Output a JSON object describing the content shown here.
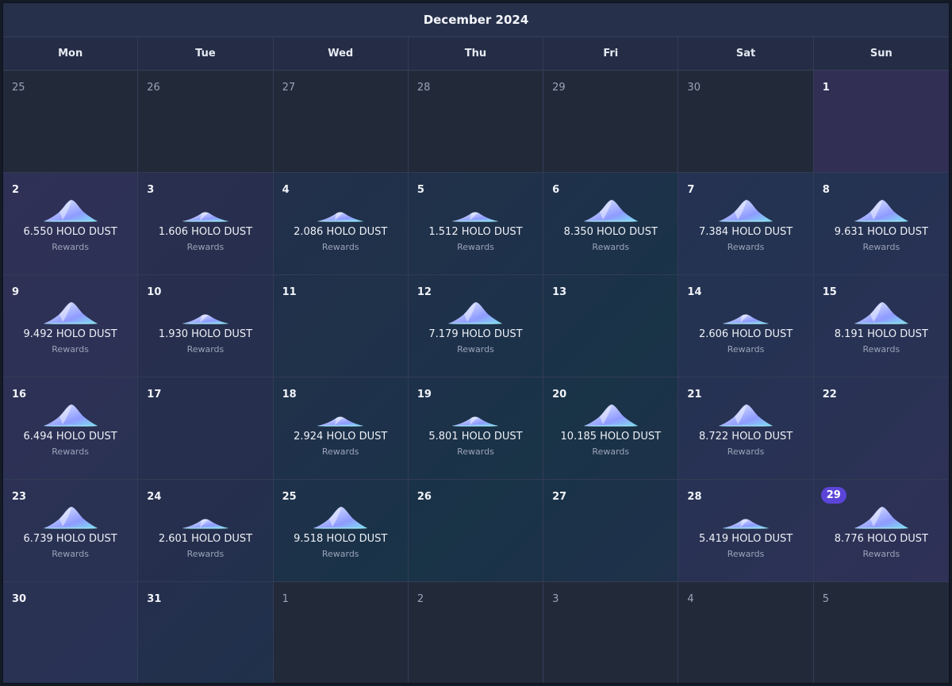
{
  "calendar": {
    "month_title": "December 2024",
    "weekdays": [
      "Mon",
      "Tue",
      "Wed",
      "Thu",
      "Fri",
      "Sat",
      "Sun"
    ],
    "reward_unit": "HOLO DUST",
    "reward_label": "Rewards",
    "today": "29",
    "reward_icon": "holo-dust-pile-icon",
    "accent_color": "#5b45d8",
    "cells": [
      {
        "day": "25",
        "outside": true
      },
      {
        "day": "26",
        "outside": true
      },
      {
        "day": "27",
        "outside": true
      },
      {
        "day": "28",
        "outside": true
      },
      {
        "day": "29",
        "outside": true
      },
      {
        "day": "30",
        "outside": true
      },
      {
        "day": "1"
      },
      {
        "day": "2",
        "amount": "6.550 HOLO DUST",
        "pile": 3
      },
      {
        "day": "3",
        "amount": "1.606 HOLO DUST",
        "pile": 1
      },
      {
        "day": "4",
        "amount": "2.086 HOLO DUST",
        "pile": 1
      },
      {
        "day": "5",
        "amount": "1.512 HOLO DUST",
        "pile": 1
      },
      {
        "day": "6",
        "amount": "8.350 HOLO DUST",
        "pile": 3
      },
      {
        "day": "7",
        "amount": "7.384 HOLO DUST",
        "pile": 3
      },
      {
        "day": "8",
        "amount": "9.631 HOLO DUST",
        "pile": 3
      },
      {
        "day": "9",
        "amount": "9.492 HOLO DUST",
        "pile": 3
      },
      {
        "day": "10",
        "amount": "1.930 HOLO DUST",
        "pile": 1
      },
      {
        "day": "11"
      },
      {
        "day": "12",
        "amount": "7.179 HOLO DUST",
        "pile": 3
      },
      {
        "day": "13"
      },
      {
        "day": "14",
        "amount": "2.606 HOLO DUST",
        "pile": 1
      },
      {
        "day": "15",
        "amount": "8.191 HOLO DUST",
        "pile": 3
      },
      {
        "day": "16",
        "amount": "6.494 HOLO DUST",
        "pile": 3
      },
      {
        "day": "17"
      },
      {
        "day": "18",
        "amount": "2.924 HOLO DUST",
        "pile": 1
      },
      {
        "day": "19",
        "amount": "5.801 HOLO DUST",
        "pile": 1
      },
      {
        "day": "20",
        "amount": "10.185 HOLO DUST",
        "pile": 3
      },
      {
        "day": "21",
        "amount": "8.722 HOLO DUST",
        "pile": 3
      },
      {
        "day": "22"
      },
      {
        "day": "23",
        "amount": "6.739 HOLO DUST",
        "pile": 3
      },
      {
        "day": "24",
        "amount": "2.601 HOLO DUST",
        "pile": 1
      },
      {
        "day": "25",
        "amount": "9.518 HOLO DUST",
        "pile": 3
      },
      {
        "day": "26"
      },
      {
        "day": "27"
      },
      {
        "day": "28",
        "amount": "5.419 HOLO DUST",
        "pile": 1
      },
      {
        "day": "29",
        "amount": "8.776 HOLO DUST",
        "pile": 3
      },
      {
        "day": "30"
      },
      {
        "day": "31"
      },
      {
        "day": "1",
        "outside": true
      },
      {
        "day": "2",
        "outside": true
      },
      {
        "day": "3",
        "outside": true
      },
      {
        "day": "4",
        "outside": true
      },
      {
        "day": "5",
        "outside": true
      }
    ]
  }
}
